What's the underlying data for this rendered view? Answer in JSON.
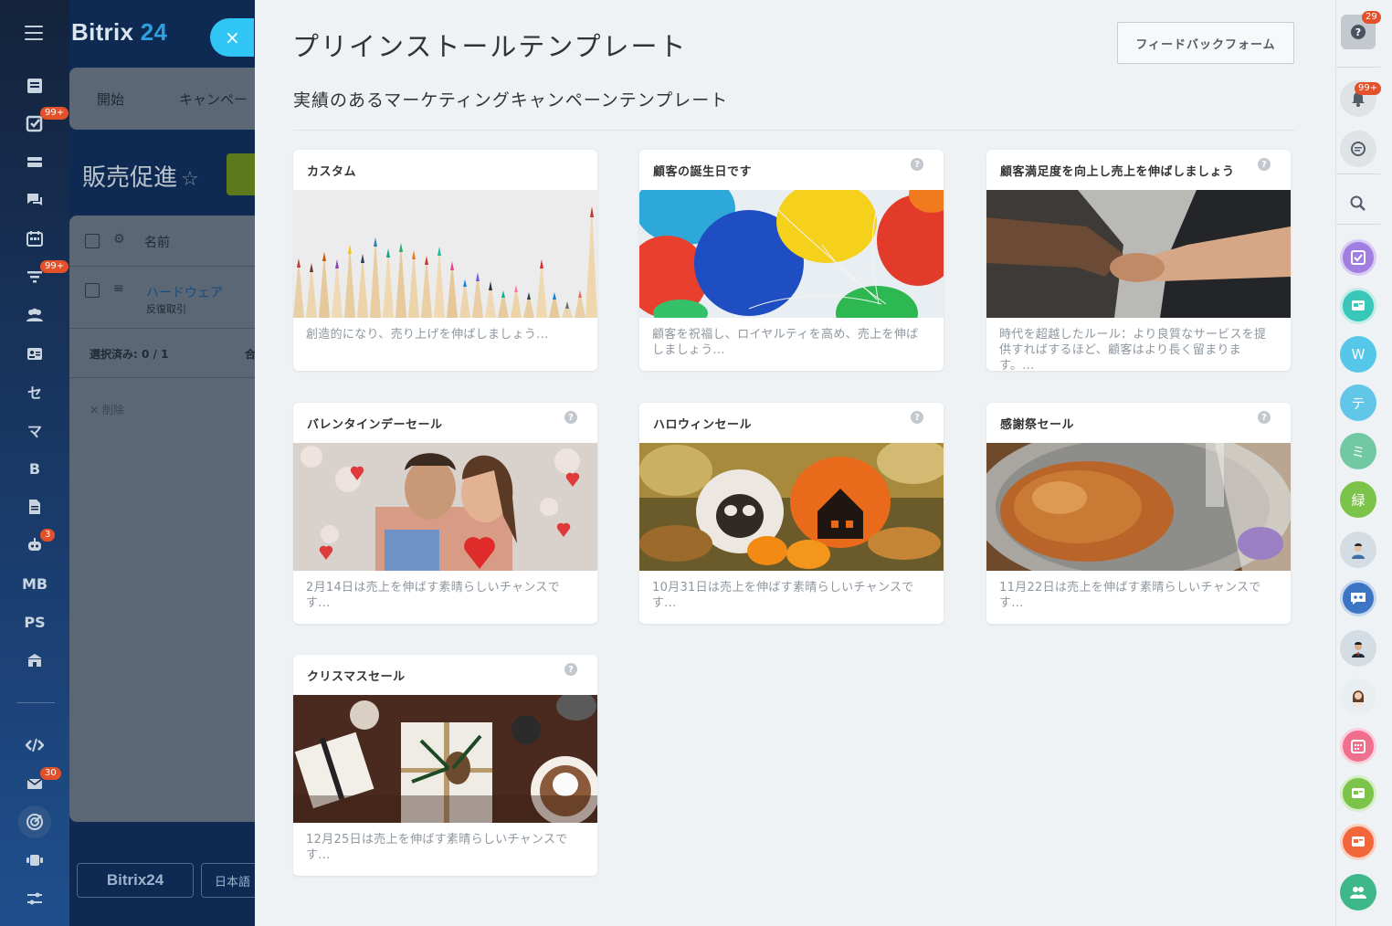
{
  "left_nav": {
    "badges": {
      "tasks": "99+",
      "filters": "99+",
      "robot": "3",
      "mail": "30"
    },
    "text_items": [
      "セ",
      "マ",
      "B",
      "MB",
      "PS"
    ]
  },
  "background_page": {
    "logo_text": "Bitrix",
    "logo_number": "24",
    "close_symbol": "×",
    "tabs": [
      "開始",
      "キャンペー"
    ],
    "page_title": "販売促進",
    "star": "☆",
    "grid": {
      "column_name": "名前",
      "row_name": "ハードウェア",
      "row_sub": "反復取引",
      "selected_label": "選択済み: 0 / 1",
      "total_label": "合",
      "delete_label": "削除"
    },
    "footer_logo": "Bitrix24",
    "footer_lang": "日本語"
  },
  "slider": {
    "title": "プリインストールテンプレート",
    "feedback_button": "フィードバックフォーム",
    "subtitle": "実績のあるマーケティングキャンペーンテンプレート",
    "help_glyph": "?",
    "cards": [
      {
        "title": "カスタム",
        "description": "創造的になり、売り上げを伸ばしましょう...",
        "image": "pencils"
      },
      {
        "title": "顧客の誕生日です",
        "description": "顧客を祝福し、ロイヤルティを高め、売上を伸ばしましょう...",
        "image": "balloons"
      },
      {
        "title": "顧客満足度を向上し売上を伸ばしましょう",
        "description": "時代を超越したルール：より良質なサービスを提供すればするほど、顧客はより長く留まります。...",
        "image": "handshake"
      },
      {
        "title": "バレンタインデーセール",
        "description": "2月14日は売上を伸ばす素晴らしいチャンスです...",
        "image": "couple"
      },
      {
        "title": "ハロウィンセール",
        "description": "10月31日は売上を伸ばす素晴らしいチャンスです...",
        "image": "pumpkins"
      },
      {
        "title": "感謝祭セール",
        "description": "11月22日は売上を伸ばす素晴らしいチャンスです...",
        "image": "turkey"
      },
      {
        "title": "クリスマスセール",
        "description": "12月25日は売上を伸ばす素晴らしいチャンスです...",
        "image": "gifts"
      }
    ]
  },
  "right_rail": {
    "help_badge": "29",
    "notifications_badge": "99+",
    "avatars": [
      {
        "letter": "W",
        "color": "#55c8ea"
      },
      {
        "letter": "テ",
        "color": "#62c6e9"
      },
      {
        "letter": "ミ",
        "color": "#71c9a4"
      },
      {
        "letter": "緑",
        "color": "#7cc34a"
      }
    ],
    "colors": {
      "tasks": "#a17fe0",
      "openline1": "#38c7b9",
      "chat": "#3d74c4",
      "calendar": "#f06f8f",
      "openline2": "#7cc34a",
      "openline3": "#f2663c",
      "group": "#3eb88a"
    }
  }
}
